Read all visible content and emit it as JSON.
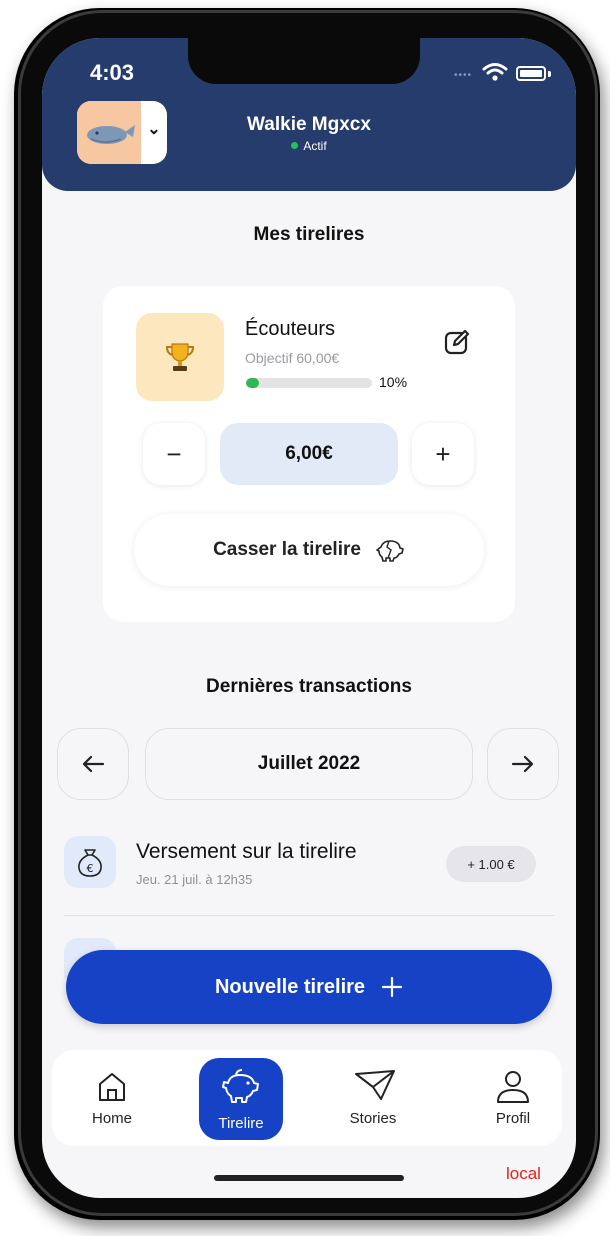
{
  "status_bar": {
    "time": "4:03"
  },
  "header": {
    "user_name": "Walkie Mgxcx",
    "user_status": "Actif"
  },
  "tirelires": {
    "section_title": "Mes tirelires",
    "card": {
      "name": "Écouteurs",
      "goal_text": "Objectif 60,00€",
      "progress_percent": 10,
      "progress_label": "10%",
      "amount": "6,00€",
      "decrement_label": "−",
      "increment_label": "+",
      "break_label": "Casser la tirelire"
    }
  },
  "transactions": {
    "section_title": "Dernières transactions",
    "month": "Juillet 2022",
    "items": [
      {
        "title": "Versement sur la tirelire",
        "date": "Jeu. 21 juil. à 12h35",
        "amount": "+ 1.00 €"
      }
    ]
  },
  "new_tirelire_label": "Nouvelle tirelire",
  "tabbar": {
    "tabs": [
      {
        "label": "Home"
      },
      {
        "label": "Tirelire",
        "active": true
      },
      {
        "label": "Stories"
      },
      {
        "label": "Profil"
      }
    ]
  },
  "env_label": "local",
  "colors": {
    "header_bg": "#263c6c",
    "accent_blue": "#1642c5",
    "progress_green": "#2fb84f",
    "goal_icon_bg": "#fde7bf",
    "status_green": "#22c45a"
  }
}
